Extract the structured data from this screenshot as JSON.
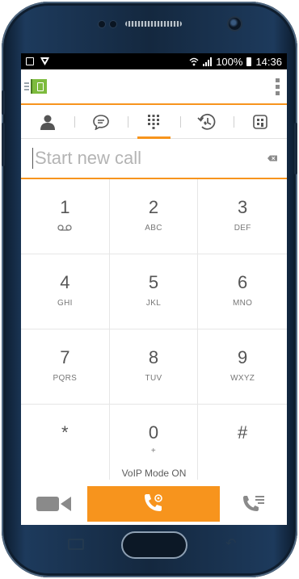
{
  "status_bar": {
    "battery_percent": "100%",
    "time": "14:36"
  },
  "tabs": [
    {
      "name": "contacts",
      "icon": "person-icon"
    },
    {
      "name": "chat",
      "icon": "chat-icon"
    },
    {
      "name": "dialpad",
      "icon": "dialpad-icon",
      "active": true
    },
    {
      "name": "history",
      "icon": "history-icon"
    },
    {
      "name": "home",
      "icon": "building-icon"
    }
  ],
  "call_input": {
    "value": "",
    "placeholder": "Start new call"
  },
  "keypad": [
    {
      "digit": "1",
      "letters": "",
      "voicemail": true
    },
    {
      "digit": "2",
      "letters": "ABC"
    },
    {
      "digit": "3",
      "letters": "DEF"
    },
    {
      "digit": "4",
      "letters": "GHI"
    },
    {
      "digit": "5",
      "letters": "JKL"
    },
    {
      "digit": "6",
      "letters": "MNO"
    },
    {
      "digit": "7",
      "letters": "PQRS"
    },
    {
      "digit": "8",
      "letters": "TUV"
    },
    {
      "digit": "9",
      "letters": "WXYZ"
    },
    {
      "digit": "*",
      "letters": ""
    },
    {
      "digit": "0",
      "letters": "+"
    },
    {
      "digit": "#",
      "letters": ""
    }
  ],
  "mode_label": "VoIP Mode ON",
  "colors": {
    "accent": "#f7941d",
    "logo_green": "#7dbb3d",
    "icon_gray": "#555555"
  }
}
